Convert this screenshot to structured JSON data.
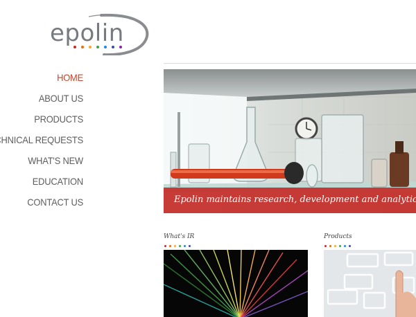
{
  "logo": {
    "text": "epolin",
    "dot_colors": [
      "#c62828",
      "#ef6c00",
      "#f9a825",
      "#43a047",
      "#1e88e5",
      "#3949ab",
      "#8e24aa"
    ]
  },
  "nav": {
    "items": [
      {
        "label": "HOME",
        "active": true
      },
      {
        "label": "ABOUT US"
      },
      {
        "label": "PRODUCTS"
      },
      {
        "label": "TECHNICAL REQUESTS"
      },
      {
        "label": "WHAT'S NEW"
      },
      {
        "label": "EDUCATION"
      },
      {
        "label": "CONTACT US"
      }
    ]
  },
  "hero": {
    "caption": "Epolin maintains research, development and analytical l"
  },
  "sections": [
    {
      "title": "What's IR"
    },
    {
      "title": "Products"
    }
  ],
  "colors": {
    "accent": "#c2452c",
    "caption_bg": "#c42d28"
  }
}
